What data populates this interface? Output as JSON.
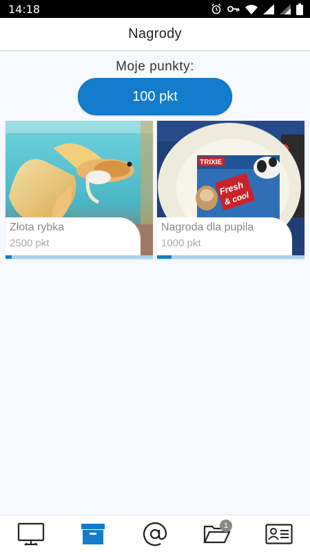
{
  "status_bar": {
    "time": "14:18",
    "icons": [
      "alarm-icon",
      "key-icon",
      "wifi-icon",
      "signal-icon",
      "signal-icon",
      "battery-icon"
    ]
  },
  "header": {
    "title": "Nagrody"
  },
  "points": {
    "label": "Moje punkty:",
    "value": "100 pkt"
  },
  "rewards": [
    {
      "name": "Złota rybka",
      "cost": "2500 pkt",
      "progress": 0.04,
      "image": "betta-fish-photo"
    },
    {
      "name": "Nagroda dla pupila",
      "cost": "1000 pkt",
      "progress": 0.1,
      "image": "trixie-pet-bowl-photo",
      "image_text": [
        "TRIXIE",
        "Fresh",
        "& cool"
      ]
    }
  ],
  "bottom_nav": {
    "items": [
      {
        "icon": "monitor-icon",
        "active": false
      },
      {
        "icon": "archive-box-icon",
        "active": true
      },
      {
        "icon": "at-sign-icon",
        "active": false
      },
      {
        "icon": "folder-open-icon",
        "active": false,
        "badge": "1"
      },
      {
        "icon": "contact-card-icon",
        "active": false
      }
    ]
  },
  "colors": {
    "accent": "#137ccd",
    "progress_track": "#a7d2ef",
    "background": "#f6f9fd"
  }
}
